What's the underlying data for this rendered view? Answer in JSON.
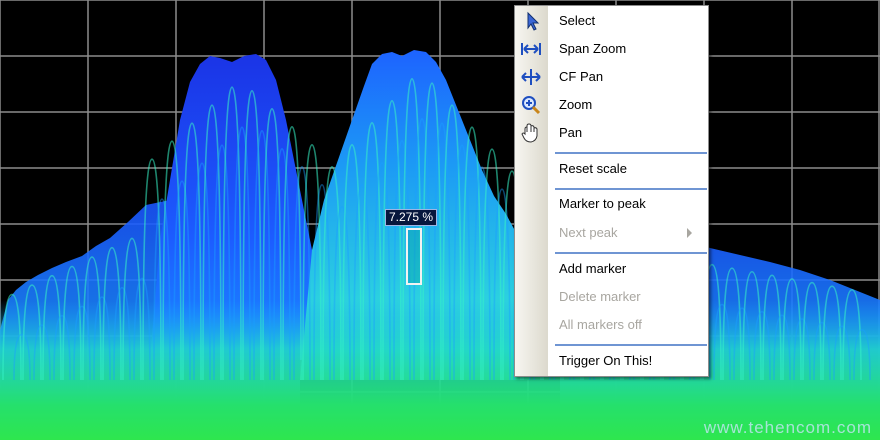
{
  "marker": {
    "readout": "7.275 %"
  },
  "context_menu": {
    "items": [
      {
        "label": "Select",
        "icon": "cursor-icon",
        "enabled": true
      },
      {
        "label": "Span Zoom",
        "icon": "span-zoom-icon",
        "enabled": true
      },
      {
        "label": "CF Pan",
        "icon": "cf-pan-icon",
        "enabled": true
      },
      {
        "label": "Zoom",
        "icon": "magnifier-icon",
        "enabled": true
      },
      {
        "label": "Pan",
        "icon": "hand-icon",
        "enabled": true
      },
      {
        "label": "Reset scale",
        "enabled": true
      },
      {
        "label": "Marker to peak",
        "enabled": true
      },
      {
        "label": "Next peak",
        "enabled": false,
        "has_submenu": true
      },
      {
        "label": "Add marker",
        "enabled": true
      },
      {
        "label": "Delete marker",
        "enabled": false
      },
      {
        "label": "All markers off",
        "enabled": false
      },
      {
        "label": "Trigger On This!",
        "enabled": true
      }
    ]
  },
  "watermark": "www.tehencom.com",
  "colors": {
    "background": "#000000",
    "grid": "#8c8c8c",
    "trace_dark": "#1d3df0",
    "trace_mid": "#1aa0ff",
    "trace_bright": "#37f3c6",
    "floor": "#23e35c",
    "menu_separator": "#6f95d3"
  }
}
